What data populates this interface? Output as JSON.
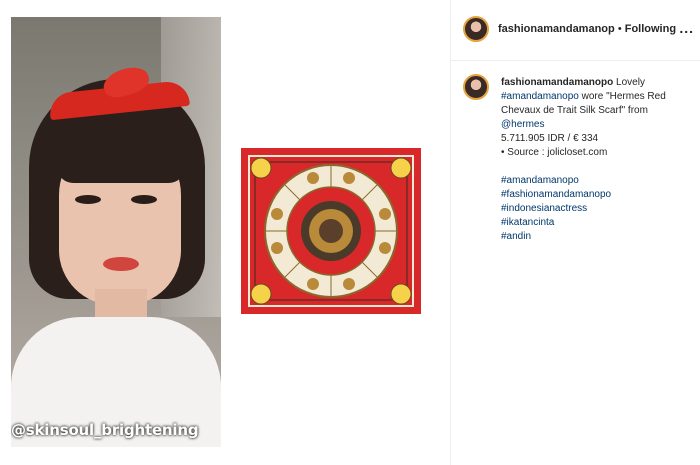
{
  "photo": {
    "overlay_tag": "@skinsoul_brightening"
  },
  "colors": {
    "scarf_red": "#d8282a",
    "scarf_cream": "#f3ead6",
    "link": "#00376b",
    "story_ring": "#e6a33e"
  },
  "header": {
    "username": "fashionamandamanop",
    "separator": "•",
    "follow_label": "Following",
    "more_label": "..."
  },
  "caption": {
    "username": "fashionamandamanopo",
    "text_1": "Lovely",
    "hashtag_1": "#amandamanopo",
    "text_2": "wore \"Hermes Red",
    "line_3": "Chevaux de Trait Silk Scarf\" from",
    "mention": "@hermes",
    "price": "5.711.905 IDR / € 334",
    "source": "• Source : jolicloset.com",
    "hashtags": [
      "#amandamanopo",
      "#fashionamandamanopo",
      "#indonesianactress",
      "#ikatancinta",
      "#andin"
    ]
  }
}
